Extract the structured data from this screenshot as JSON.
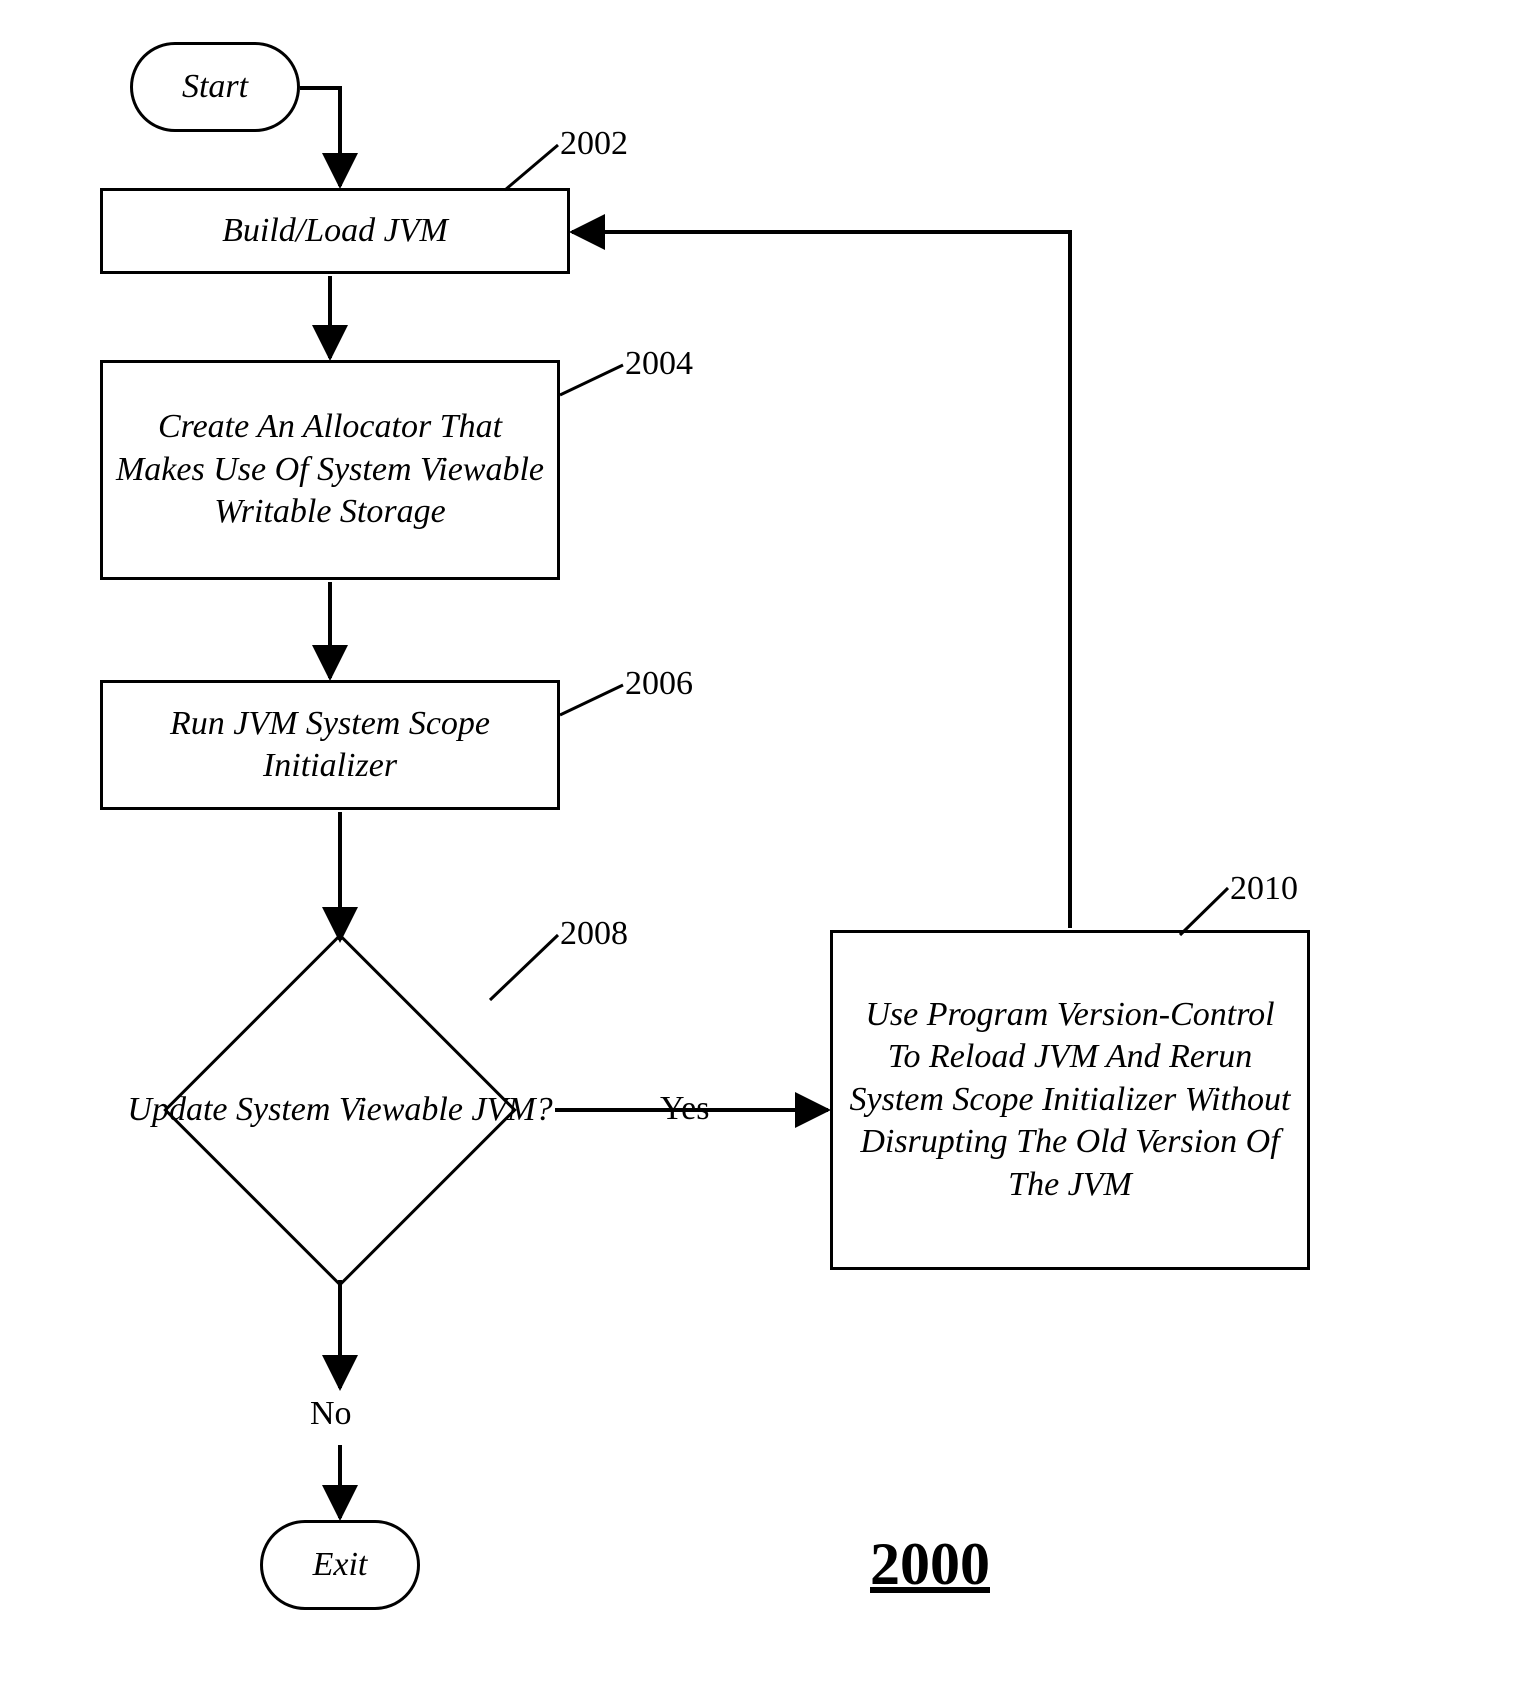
{
  "flowchart": {
    "start": "Start",
    "exit": "Exit",
    "step_build_load": "Build/Load JVM",
    "step_allocator": "Create An Allocator That Makes Use Of System Viewable Writable Storage",
    "step_initializer": "Run JVM System Scope Initializer",
    "decision_update": "Update System Viewable JVM?",
    "step_version_control": "Use Program Version-Control To Reload JVM And Rerun System Scope Initializer Without Disrupting The Old Version Of The JVM",
    "edge_yes": "Yes",
    "edge_no": "No"
  },
  "callouts": {
    "c2002": "2002",
    "c2004": "2004",
    "c2006": "2006",
    "c2008": "2008",
    "c2010": "2010"
  },
  "figure_number": "2000"
}
